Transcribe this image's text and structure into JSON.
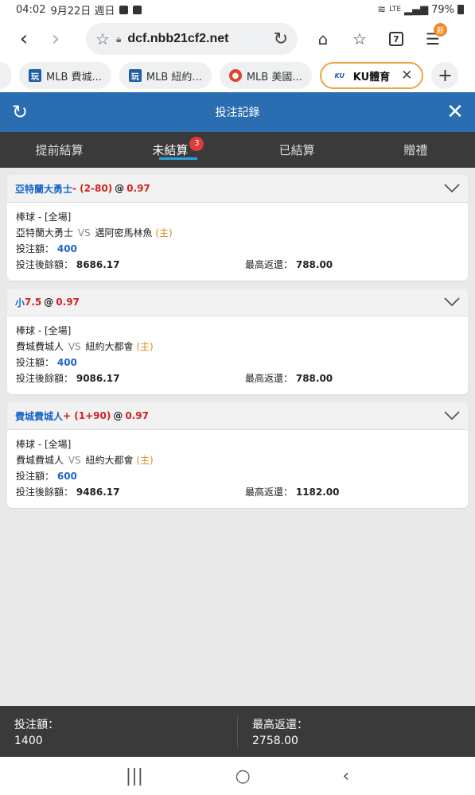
{
  "status": {
    "time": "04:02",
    "date": "9月22日 週日",
    "signal": "LTE",
    "battery": "79%"
  },
  "browser": {
    "url": "dcf.nbb21cf2.net",
    "tabs": [
      {
        "label": "MLB 費城..."
      },
      {
        "label": "MLB 紐約..."
      },
      {
        "label": "MLB 美國..."
      },
      {
        "label": "KU體育",
        "favicon_text": "KU"
      }
    ],
    "tab_count": "7",
    "new_badge": "新"
  },
  "app": {
    "title": "投注記錄",
    "tabs": [
      {
        "label": "提前結算"
      },
      {
        "label": "未結算",
        "badge": "3"
      },
      {
        "label": "已結算"
      },
      {
        "label": "贈禮"
      }
    ]
  },
  "bets": [
    {
      "team": "亞特蘭大勇士",
      "handicap": " - (2-80)",
      "at": "@",
      "odds": "0.97",
      "sport": "棒球 - [全場]",
      "home_team": "亞特蘭大勇士",
      "vs": "VS",
      "away_team": "邁阿密馬林魚",
      "home_marker": "(主)",
      "stake_label": "投注額：",
      "stake": "400",
      "balance_label": "投注後餘額：",
      "balance": "8686.17",
      "return_label": "最高返還：",
      "max_return": "788.00"
    },
    {
      "team": "小",
      "handicap": " 7.5",
      "at": "@",
      "odds": "0.97",
      "sport": "棒球 - [全場]",
      "home_team": "費城費城人",
      "vs": "VS",
      "away_team": "紐約大都會",
      "home_marker": "(主)",
      "stake_label": "投注額：",
      "stake": "400",
      "balance_label": "投注後餘額：",
      "balance": "9086.17",
      "return_label": "最高返還：",
      "max_return": "788.00"
    },
    {
      "team": "費城費城人",
      "handicap": " + (1+90)",
      "at": "@",
      "odds": "0.97",
      "sport": "棒球 - [全場]",
      "home_team": "費城費城人",
      "vs": "VS",
      "away_team": "紐約大都會",
      "home_marker": "(主)",
      "stake_label": "投注額：",
      "stake": "600",
      "balance_label": "投注後餘額：",
      "balance": "9486.17",
      "return_label": "最高返還：",
      "max_return": "1182.00"
    }
  ],
  "footer": {
    "stake_label": "投注額：",
    "stake_total": "1400",
    "return_label": "最高返還：",
    "return_total": "2758.00"
  },
  "colors": {
    "header": "#2a6db0",
    "tabs_bg": "#3a3a3a",
    "accent": "#27a4e6",
    "team_blue": "#1a66c8",
    "odds_red": "#d4231f",
    "home_orange": "#e08a1c"
  }
}
